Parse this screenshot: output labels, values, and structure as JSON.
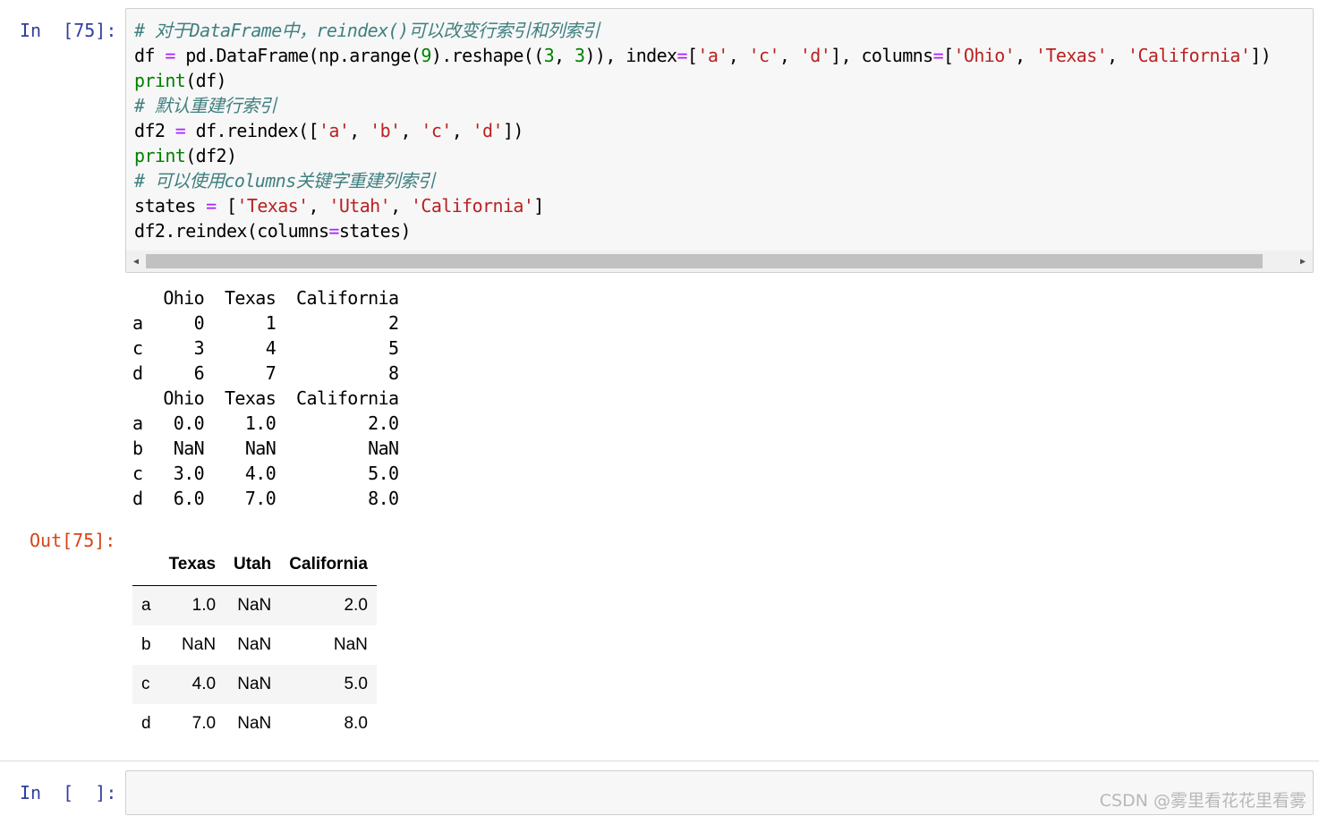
{
  "cells": {
    "cell1": {
      "in_prompt": "In  [75]:",
      "out_prompt": "Out[75]:",
      "code_lines": [
        "# 对于DataFrame中，reindex()可以改变行索引和列索引",
        "df = pd.DataFrame(np.arange(9).reshape((3, 3)), index=['a', 'c', 'd'], columns=['Ohio', 'Texas', 'California'])",
        "print(df)",
        "# 默认重建行索引",
        "df2 = df.reindex(['a', 'b', 'c', 'd'])",
        "print(df2)",
        "# 可以使用columns关键字重建列索引",
        "states = ['Texas', 'Utah', 'California']",
        "df2.reindex(columns=states)"
      ],
      "stdout": "   Ohio  Texas  California\na     0      1           2\nc     3      4           5\nd     6      7           8\n   Ohio  Texas  California\na   0.0    1.0         2.0\nb   NaN    NaN         NaN\nc   3.0    4.0         5.0\nd   6.0    7.0         8.0",
      "output_table": {
        "columns": [
          "",
          "Texas",
          "Utah",
          "California"
        ],
        "rows": [
          [
            "a",
            "1.0",
            "NaN",
            "2.0"
          ],
          [
            "b",
            "NaN",
            "NaN",
            "NaN"
          ],
          [
            "c",
            "4.0",
            "NaN",
            "5.0"
          ],
          [
            "d",
            "7.0",
            "NaN",
            "8.0"
          ]
        ]
      }
    },
    "cell2": {
      "in_prompt": "In  [  ]:"
    }
  },
  "scrollbar": {
    "left_arrow": "◀",
    "right_arrow": "▶"
  },
  "watermark": "CSDN @雾里看花花里看雾",
  "colors": {
    "in_prompt": "#303f9f",
    "out_prompt": "#d84315",
    "comment": "#408080",
    "string": "#ba2121",
    "number": "#008000",
    "operator": "#aa22ff"
  }
}
